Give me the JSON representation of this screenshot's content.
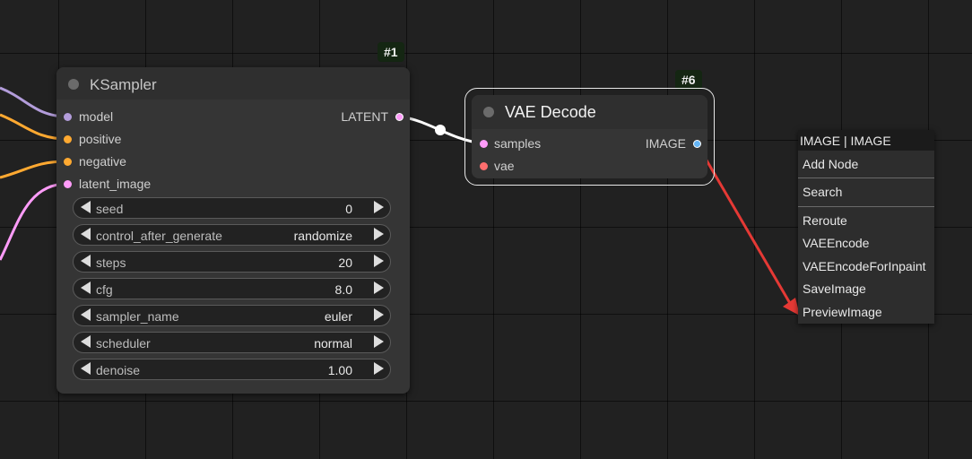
{
  "canvas": {
    "background": "#212121"
  },
  "ksampler": {
    "badge": "#1",
    "title": "KSampler",
    "inputs": [
      {
        "label": "model",
        "color": "#b39ddb"
      },
      {
        "label": "positive",
        "color": "#ffa931"
      },
      {
        "label": "negative",
        "color": "#ffa931"
      },
      {
        "label": "latent_image",
        "color": "#ff9cf9"
      }
    ],
    "output": {
      "label": "LATENT",
      "color": "#ff9cf9"
    },
    "widgets": [
      {
        "name": "seed",
        "value": "0"
      },
      {
        "name": "control_after_generate",
        "value": "randomize"
      },
      {
        "name": "steps",
        "value": "20"
      },
      {
        "name": "cfg",
        "value": "8.0"
      },
      {
        "name": "sampler_name",
        "value": "euler"
      },
      {
        "name": "scheduler",
        "value": "normal"
      },
      {
        "name": "denoise",
        "value": "1.00"
      }
    ]
  },
  "vae_decode": {
    "badge": "#6",
    "title": "VAE Decode",
    "inputs": [
      {
        "label": "samples",
        "color": "#ff9cf9"
      },
      {
        "label": "vae",
        "color": "#ff6e6e"
      }
    ],
    "output": {
      "label": "IMAGE",
      "color": "#64b5f6"
    }
  },
  "context_menu": {
    "header": "IMAGE | IMAGE",
    "add_node": "Add Node",
    "search": "Search",
    "items": [
      "Reroute",
      "VAEEncode",
      "VAEEncodeForInpaint",
      "SaveImage",
      "PreviewImage"
    ]
  },
  "drag_link_color": "#e53935"
}
